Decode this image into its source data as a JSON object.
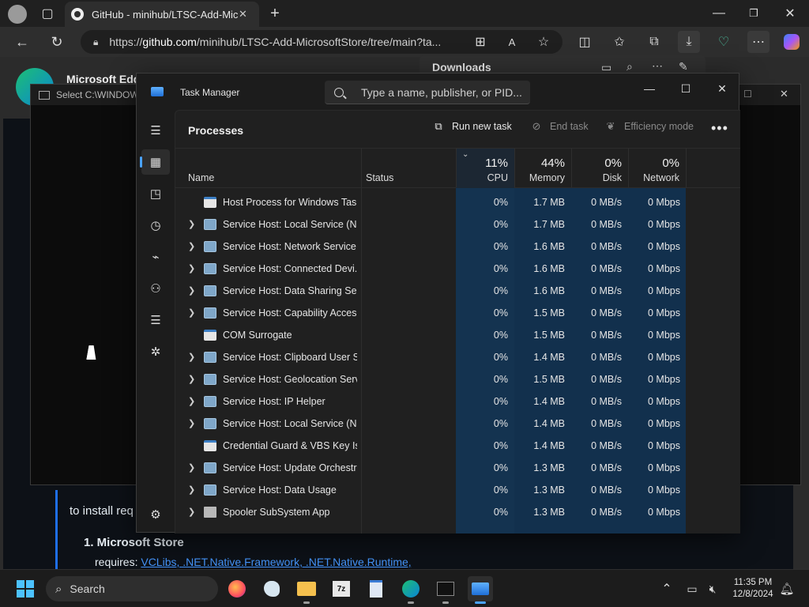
{
  "browser": {
    "tab_title": "GitHub - minihub/LTSC-Add-Micr",
    "url_prefix": "https://",
    "url_host": "github.com",
    "url_path": "/minihub/LTSC-Add-MicrosoftStore/tree/main?ta...",
    "downloads_label": "Downloads",
    "edge_label": "Microsoft Edg",
    "page_text_1": "to install req",
    "page_list_item": "1. Microsoft Store",
    "page_requires": "requires:",
    "page_links": "VCLibs, .NET.Native.Framework, .NET.Native.Runtime,"
  },
  "console": {
    "title": "Select C:\\WINDOWS"
  },
  "taskmanager": {
    "title": "Task Manager",
    "search_placeholder": "Type a name, publisher, or PID...",
    "heading": "Processes",
    "run_new_task": "Run new task",
    "end_task": "End task",
    "efficiency_mode": "Efficiency mode",
    "more": "•••",
    "columns": {
      "name": "Name",
      "status": "Status",
      "cpu_pct": "11%",
      "cpu": "CPU",
      "memory_pct": "44%",
      "memory": "Memory",
      "disk_pct": "0%",
      "disk": "Disk",
      "network_pct": "0%",
      "network": "Network"
    },
    "rows": [
      {
        "name": "Host Process for Windows Tasks",
        "cpu": "0%",
        "memory": "1.7 MB",
        "disk": "0 MB/s",
        "network": "0 Mbps",
        "expandable": false,
        "icon": "win"
      },
      {
        "name": "Service Host: Local Service (N...",
        "cpu": "0%",
        "memory": "1.7 MB",
        "disk": "0 MB/s",
        "network": "0 Mbps",
        "expandable": true,
        "icon": "gear"
      },
      {
        "name": "Service Host: Network Service",
        "cpu": "0%",
        "memory": "1.6 MB",
        "disk": "0 MB/s",
        "network": "0 Mbps",
        "expandable": true,
        "icon": "gear"
      },
      {
        "name": "Service Host: Connected Devi...",
        "cpu": "0%",
        "memory": "1.6 MB",
        "disk": "0 MB/s",
        "network": "0 Mbps",
        "expandable": true,
        "icon": "gear"
      },
      {
        "name": "Service Host: Data Sharing Ser...",
        "cpu": "0%",
        "memory": "1.6 MB",
        "disk": "0 MB/s",
        "network": "0 Mbps",
        "expandable": true,
        "icon": "gear"
      },
      {
        "name": "Service Host: Capability Acces...",
        "cpu": "0%",
        "memory": "1.5 MB",
        "disk": "0 MB/s",
        "network": "0 Mbps",
        "expandable": true,
        "icon": "gear"
      },
      {
        "name": "COM Surrogate",
        "cpu": "0%",
        "memory": "1.5 MB",
        "disk": "0 MB/s",
        "network": "0 Mbps",
        "expandable": false,
        "icon": "win"
      },
      {
        "name": "Service Host: Clipboard User S...",
        "cpu": "0%",
        "memory": "1.4 MB",
        "disk": "0 MB/s",
        "network": "0 Mbps",
        "expandable": true,
        "icon": "gear"
      },
      {
        "name": "Service Host: Geolocation Serv...",
        "cpu": "0%",
        "memory": "1.5 MB",
        "disk": "0 MB/s",
        "network": "0 Mbps",
        "expandable": true,
        "icon": "gear"
      },
      {
        "name": "Service Host: IP Helper",
        "cpu": "0%",
        "memory": "1.4 MB",
        "disk": "0 MB/s",
        "network": "0 Mbps",
        "expandable": true,
        "icon": "gear"
      },
      {
        "name": "Service Host: Local Service (N...",
        "cpu": "0%",
        "memory": "1.4 MB",
        "disk": "0 MB/s",
        "network": "0 Mbps",
        "expandable": true,
        "icon": "gear"
      },
      {
        "name": "Credential Guard & VBS Key Is...",
        "cpu": "0%",
        "memory": "1.4 MB",
        "disk": "0 MB/s",
        "network": "0 Mbps",
        "expandable": false,
        "icon": "win"
      },
      {
        "name": "Service Host: Update Orchestr...",
        "cpu": "0%",
        "memory": "1.3 MB",
        "disk": "0 MB/s",
        "network": "0 Mbps",
        "expandable": true,
        "icon": "gear"
      },
      {
        "name": "Service Host: Data Usage",
        "cpu": "0%",
        "memory": "1.3 MB",
        "disk": "0 MB/s",
        "network": "0 Mbps",
        "expandable": true,
        "icon": "gear"
      },
      {
        "name": "Spooler SubSystem App",
        "cpu": "0%",
        "memory": "1.3 MB",
        "disk": "0 MB/s",
        "network": "0 Mbps",
        "expandable": true,
        "icon": "printer"
      }
    ]
  },
  "taskbar": {
    "search_label": "Search",
    "time": "11:35 PM",
    "date": "12/8/2024"
  },
  "colors": {
    "accent": "#4aa3ff",
    "heat": "#12304d"
  }
}
